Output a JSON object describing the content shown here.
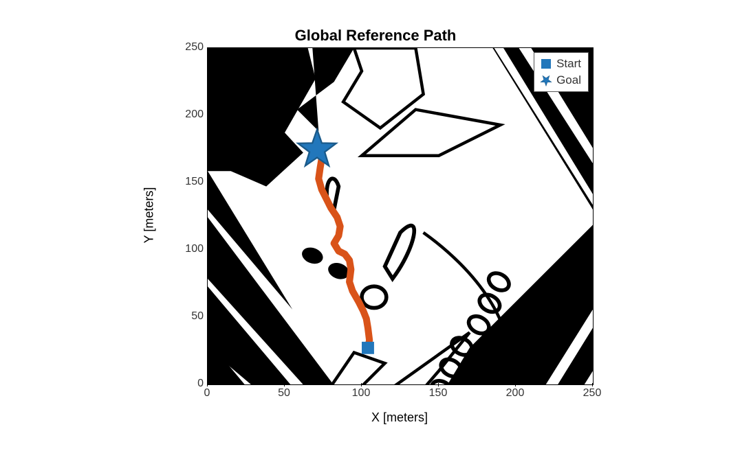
{
  "chart_data": {
    "type": "line",
    "title": "Global Reference Path",
    "xlabel": "X [meters]",
    "ylabel": "Y [meters]",
    "xlim": [
      0,
      250
    ],
    "ylim": [
      0,
      250
    ],
    "xticks": [
      0,
      50,
      100,
      150,
      200,
      250
    ],
    "yticks": [
      0,
      50,
      100,
      150,
      200,
      250
    ],
    "legend": {
      "position": "northeast",
      "entries": [
        {
          "label": "Start",
          "marker": "square",
          "color": "#2277bb"
        },
        {
          "label": "Goal",
          "marker": "pentagram",
          "color": "#2277bb"
        }
      ]
    },
    "markers": {
      "start": {
        "x": 104,
        "y": 55
      },
      "goal": {
        "x": 71,
        "y": 184
      }
    },
    "path": {
      "x": [
        104,
        105,
        104,
        103,
        101,
        98,
        94,
        92,
        93,
        92,
        89,
        85,
        82,
        85,
        86,
        84,
        80,
        77,
        74,
        72,
        73,
        74,
        72,
        71
      ],
      "y": [
        55,
        60,
        68,
        74,
        79,
        85,
        92,
        98,
        106,
        112,
        116,
        118,
        123,
        128,
        134,
        140,
        146,
        152,
        158,
        165,
        172,
        178,
        182,
        184
      ]
    },
    "background": "binary-occupancy-map"
  }
}
